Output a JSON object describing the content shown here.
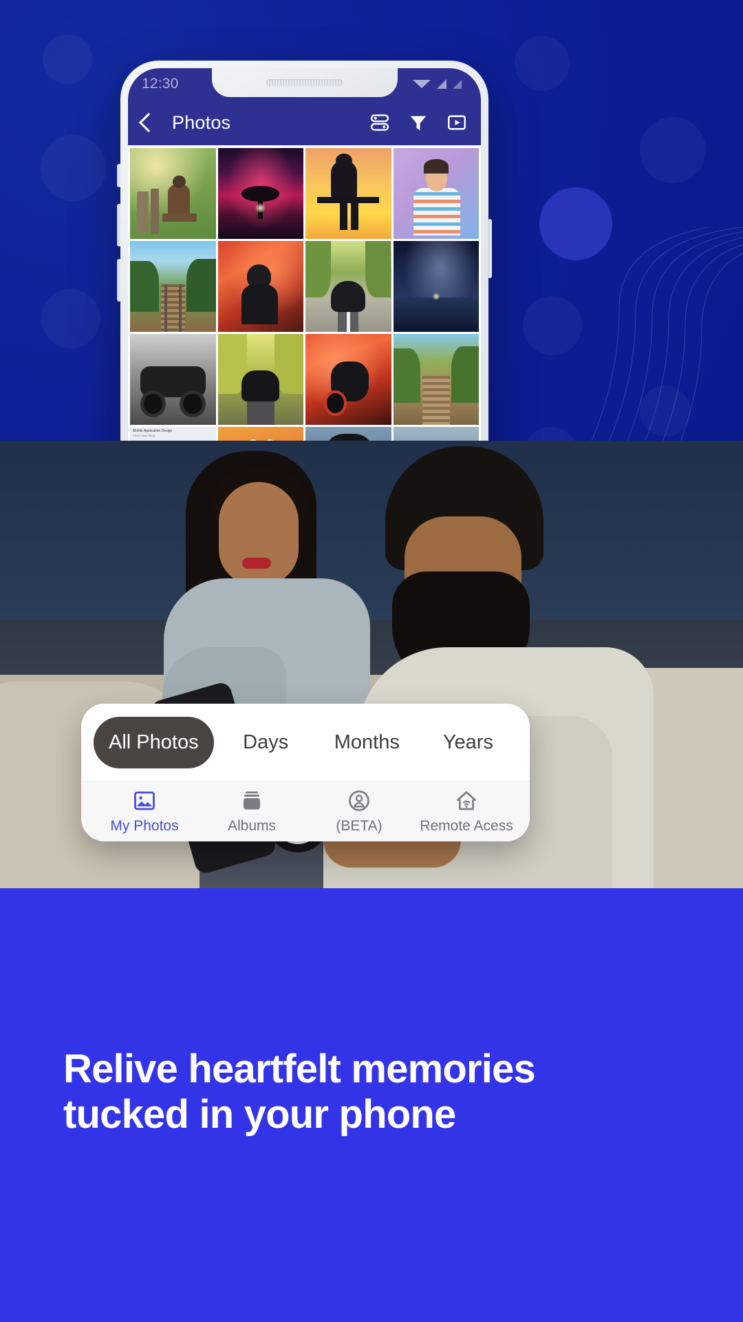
{
  "background": {
    "color_deep": "#0a1a9e",
    "color_vivid": "#3333e8"
  },
  "phone": {
    "status_bar": {
      "time": "12:30",
      "icons": [
        "wifi-icon",
        "signal-icon",
        "signal-weak-icon"
      ]
    },
    "app_bar": {
      "back_label": "back-chevron",
      "title": "Photos",
      "actions": [
        {
          "name": "list-view-icon"
        },
        {
          "name": "filter-icon"
        },
        {
          "name": "slideshow-icon"
        }
      ]
    },
    "photo_grid": {
      "columns": 4,
      "items": [
        {
          "id": "child-on-bench",
          "alt": "Child sitting on wooden bench in garden"
        },
        {
          "id": "glowing-tree",
          "alt": "Glowing tree under magenta sky"
        },
        {
          "id": "sunset-silhouette",
          "alt": "Person silhouette on bench at sunset"
        },
        {
          "id": "girl-purple",
          "alt": "Girl in striped sweater on purple background"
        },
        {
          "id": "railway-forest",
          "alt": "Railway track through green forest"
        },
        {
          "id": "red-smoke-biker",
          "alt": "Biker with red smoke flare"
        },
        {
          "id": "motorcycle-road",
          "alt": "Motorcycle on tree lined road"
        },
        {
          "id": "night-lake",
          "alt": "Starry night over lake"
        },
        {
          "id": "bw-motorcycle",
          "alt": "Black and white classic motorcycle"
        },
        {
          "id": "bike-yellow-road",
          "alt": "Motorbike on yellow tree road"
        },
        {
          "id": "red-smoke-bike2",
          "alt": "Motorbike with red smoke"
        },
        {
          "id": "railway-track-2",
          "alt": "Railway track in autumn forest"
        },
        {
          "id": "ui-case-study",
          "alt": "Mobile application design case study",
          "caption_title": "Mobile Application Design",
          "caption_sub": "UI/UX Case Study"
        },
        {
          "id": "white-kitten",
          "alt": "White kitten with water splash"
        },
        {
          "id": "man-turban-port",
          "alt": "Man in turban at harbour"
        },
        {
          "id": "harbour-cranes",
          "alt": "Harbour cranes at dusk"
        }
      ]
    },
    "tabs": [
      {
        "label": "All Photos",
        "active": true
      },
      {
        "label": "Days",
        "active": false
      },
      {
        "label": "Months",
        "active": false
      },
      {
        "label": "Years",
        "active": false
      }
    ],
    "bottom_nav": [
      {
        "label": "My Photos",
        "icon": "image-icon",
        "active": true
      },
      {
        "label": "Albums",
        "icon": "albums-icon",
        "active": false
      },
      {
        "label": "(BETA)",
        "icon": "person-circle-icon",
        "active": false
      },
      {
        "label": "Remote Acess",
        "icon": "home-wifi-icon",
        "active": false
      }
    ]
  },
  "hero_photo": {
    "alt": "Couple sitting on a couch looking at a smartphone together"
  },
  "headline": {
    "text": "Relive heartfelt memories tucked in your phone"
  }
}
